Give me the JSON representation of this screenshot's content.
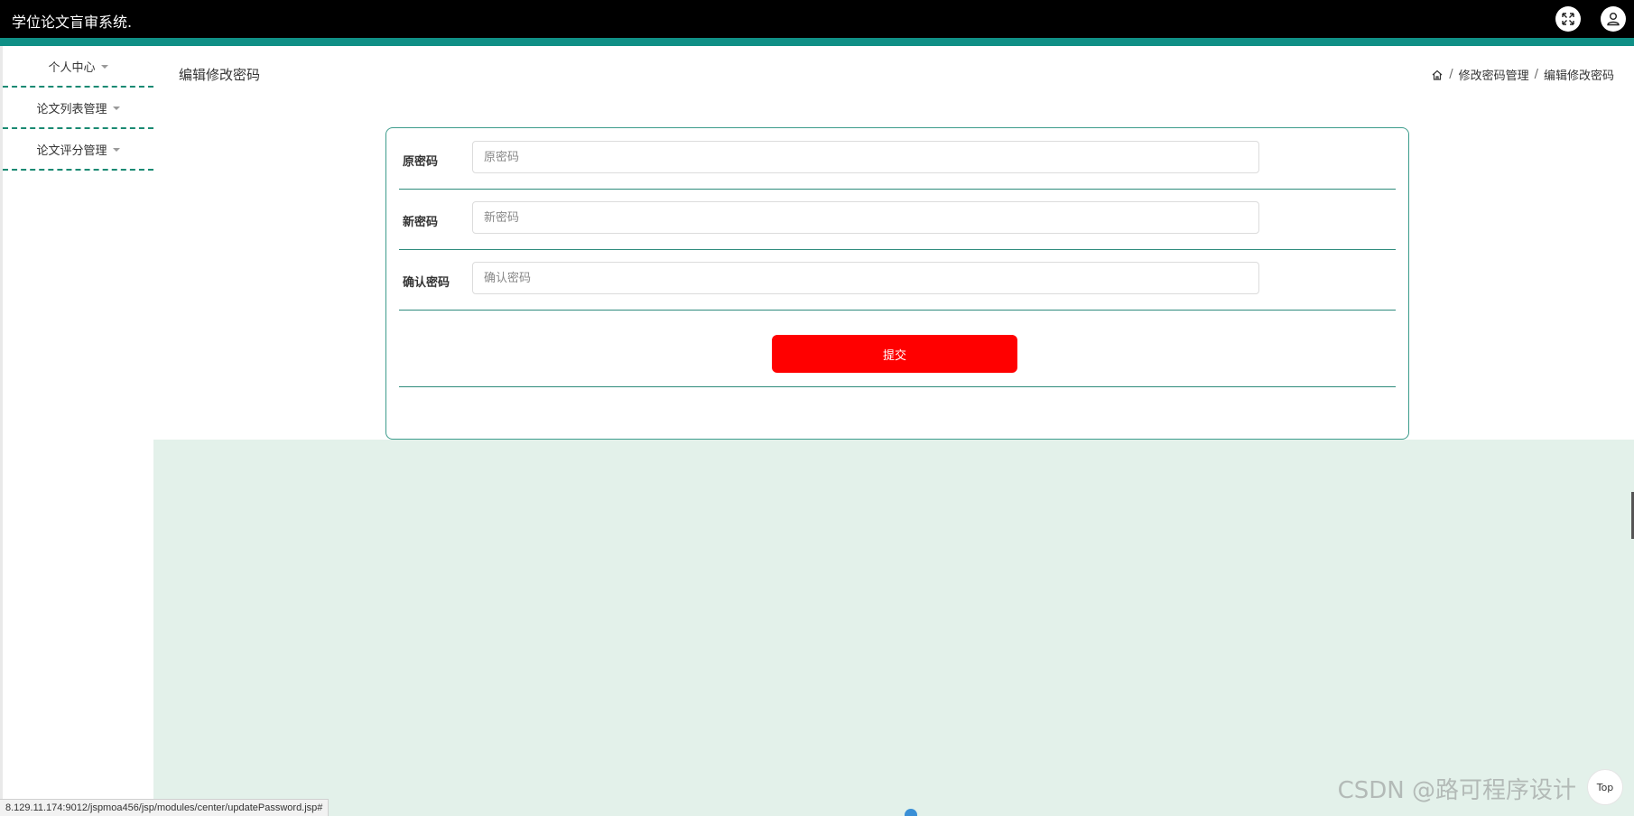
{
  "app": {
    "title": "学位论文盲审系统."
  },
  "header": {
    "fullscreen_icon": "fullscreen-icon",
    "user_icon": "user-icon",
    "accent_color": "#0f8f86"
  },
  "sidebar": {
    "items": [
      {
        "label": "个人中心"
      },
      {
        "label": "论文列表管理"
      },
      {
        "label": "论文评分管理"
      }
    ]
  },
  "main": {
    "page_title": "编辑修改密码",
    "breadcrumb": {
      "home_icon": "home-icon",
      "separator": "/",
      "items": [
        "修改密码管理",
        "编辑修改密码"
      ]
    },
    "form": {
      "old_password": {
        "label": "原密码",
        "placeholder": "原密码",
        "value": ""
      },
      "new_password": {
        "label": "新密码",
        "placeholder": "新密码",
        "value": ""
      },
      "confirm_password": {
        "label": "确认密码",
        "placeholder": "确认密码",
        "value": ""
      },
      "submit_label": "提交",
      "submit_color": "#ff0000"
    }
  },
  "status_bar": {
    "url": "8.129.11.174:9012/jspmoa456/jsp/modules/center/updatePassword.jsp#"
  },
  "back_to_top": {
    "label": "Top"
  },
  "watermark": {
    "text": "CSDN @路可程序设计"
  }
}
